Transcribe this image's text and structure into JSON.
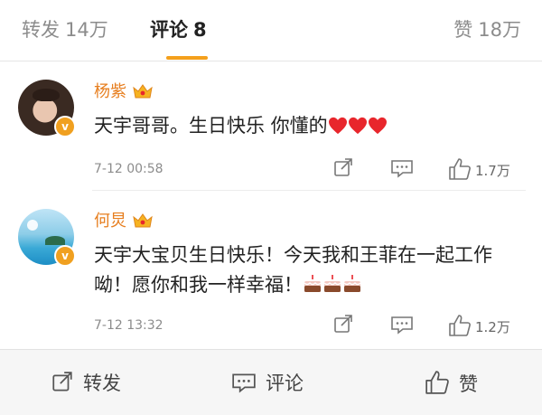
{
  "tabs": {
    "reposts": {
      "label": "转发",
      "count": "14万"
    },
    "comments": {
      "label": "评论",
      "count": "8"
    },
    "likes": {
      "label": "赞",
      "count": "18万"
    },
    "active": "comments"
  },
  "comments": [
    {
      "username": "杨紫",
      "text": "天宇哥哥。生日快乐 你懂的",
      "emoji": [
        "heart",
        "heart",
        "heart"
      ],
      "timestamp": "7-12 00:58",
      "like_count": "1.7万"
    },
    {
      "username": "何炅",
      "text": "天宇大宝贝生日快乐！今天我和王菲在一起工作呦！愿你和我一样幸福！",
      "emoji": [
        "cake",
        "cake",
        "cake"
      ],
      "timestamp": "7-12 13:32",
      "like_count": "1.2万"
    }
  ],
  "bottom_bar": {
    "repost_label": "转发",
    "comment_label": "评论",
    "like_label": "赞"
  },
  "colors": {
    "accent": "#f4a01c",
    "username": "#e77f20",
    "heart": "#e8262c"
  }
}
